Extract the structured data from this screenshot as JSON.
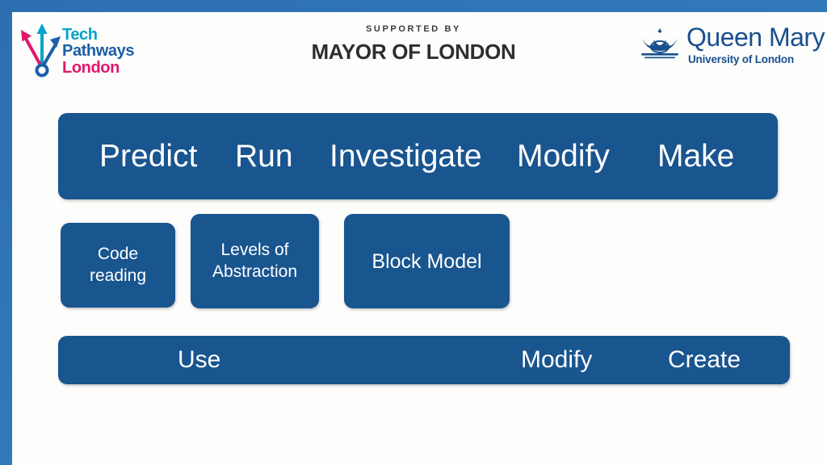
{
  "theme": {
    "frame_blue": "#2f74b6",
    "block_blue": "#19558f",
    "block_text": "#ffffff",
    "page_background": "#fdfdfc"
  },
  "header": {
    "tech_pathways_logo": {
      "line1": "Tech",
      "line2": "Pathways",
      "line3": "London",
      "line1_color": "#00a4c8",
      "line2_color": "#1b5fa8",
      "line3_color": "#e1176b"
    },
    "mayor_logo": {
      "supported_by": "SUPPORTED BY",
      "name": "MAYOR OF LONDON"
    },
    "queen_mary_logo": {
      "name": "Queen Mary",
      "subtitle": "University of London",
      "color": "#19508f"
    }
  },
  "content": {
    "top_bar": {
      "items": [
        {
          "label": "Predict"
        },
        {
          "label": "Run"
        },
        {
          "label": "Investigate"
        },
        {
          "label": "Modify"
        },
        {
          "label": "Make"
        }
      ]
    },
    "cards": [
      {
        "label": "Code\nreading"
      },
      {
        "label": "Levels of\nAbstraction"
      },
      {
        "label": "Block Model"
      }
    ],
    "bottom_bar": {
      "items": [
        {
          "label": "Use"
        },
        {
          "label": "Modify"
        },
        {
          "label": "Create"
        }
      ]
    }
  }
}
